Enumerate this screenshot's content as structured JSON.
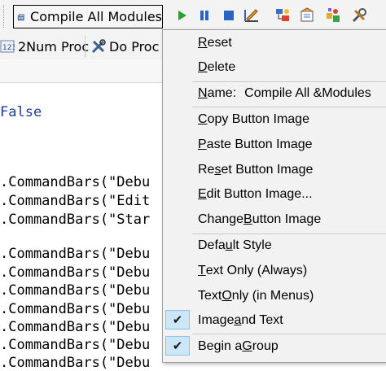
{
  "toolbar_top": {
    "compile_button": "Compile All Modules",
    "buttons": [
      "run-icon",
      "pause-icon",
      "stop-icon",
      "design-mode-icon",
      "project-explorer-icon",
      "properties-icon",
      "object-browser-icon",
      "toolbox-icon"
    ]
  },
  "toolbar_second": {
    "numproc_button": "2Num Proc",
    "doproc_button": "Do Proc"
  },
  "code": {
    "false_line": "False",
    "lines": [
      ".CommandBars(\"Debu",
      ".CommandBars(\"Edit",
      ".CommandBars(\"Star",
      ".CommandBars(\"Debu",
      ".CommandBars(\"Debu",
      ".CommandBars(\"Debu",
      ".CommandBars(\"Debu",
      ".CommandBars(\"Debu",
      ".CommandBars(\"Debu",
      ".CommandBars(\"Debu"
    ]
  },
  "menu": {
    "reset": {
      "pre": "",
      "ul": "R",
      "post": "eset"
    },
    "delete": {
      "pre": "",
      "ul": "D",
      "post": "elete"
    },
    "name": {
      "pre": "",
      "ul": "N",
      "post": "ame:",
      "value": "Compile All &Modules"
    },
    "copy_image": {
      "pre": "",
      "ul": "C",
      "post": "opy Button Image"
    },
    "paste_image": {
      "pre": "",
      "ul": "P",
      "post": "aste Button Image"
    },
    "reset_image": {
      "pre": "Re",
      "ul": "s",
      "post": "et Button Image"
    },
    "edit_image": {
      "pre": "",
      "ul": "E",
      "post": "dit Button Image..."
    },
    "change_image": {
      "pre": "Change ",
      "ul": "B",
      "post": "utton Image"
    },
    "default_style": {
      "pre": "Defa",
      "ul": "u",
      "post": "lt Style"
    },
    "text_only_always": {
      "pre": "",
      "ul": "T",
      "post": "ext Only (Always)"
    },
    "text_only_menus": {
      "pre": "Text ",
      "ul": "O",
      "post": "nly (in Menus)"
    },
    "image_and_text": {
      "pre": "Image ",
      "ul": "a",
      "post": "nd Text"
    },
    "begin_group": {
      "pre": "Begin a ",
      "ul": "G",
      "post": "roup"
    },
    "check_glyph": "✔"
  }
}
